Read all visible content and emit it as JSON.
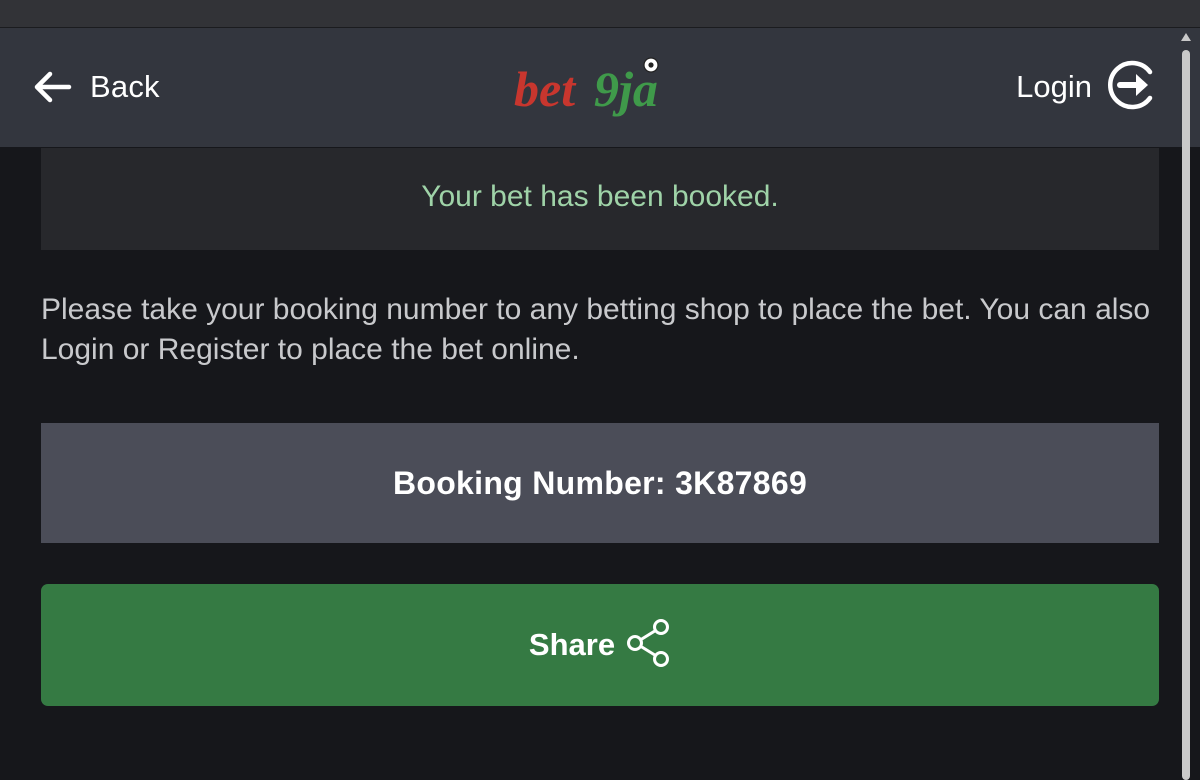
{
  "header": {
    "back_label": "Back",
    "logo_text": "bet9ja",
    "login_label": "Login"
  },
  "notice": {
    "message": "Your bet has been booked."
  },
  "instructions": {
    "text": "Please take your booking number to any betting shop to place the bet. You can also Login or Register to place the bet online."
  },
  "booking": {
    "label": "Booking Number: 3K87869"
  },
  "share": {
    "label": "Share"
  },
  "icons": {
    "back": "arrow-left-icon",
    "login": "login-arrow-circle-icon",
    "share": "share-nodes-icon"
  },
  "colors": {
    "background": "#16171b",
    "header": "#33363e",
    "notice_bg": "#27282c",
    "notice_text": "#9fd3a8",
    "booking_bg": "#4b4d58",
    "share_button": "#357a43",
    "logo_red": "#c8362e",
    "logo_green": "#3f9a4a"
  }
}
